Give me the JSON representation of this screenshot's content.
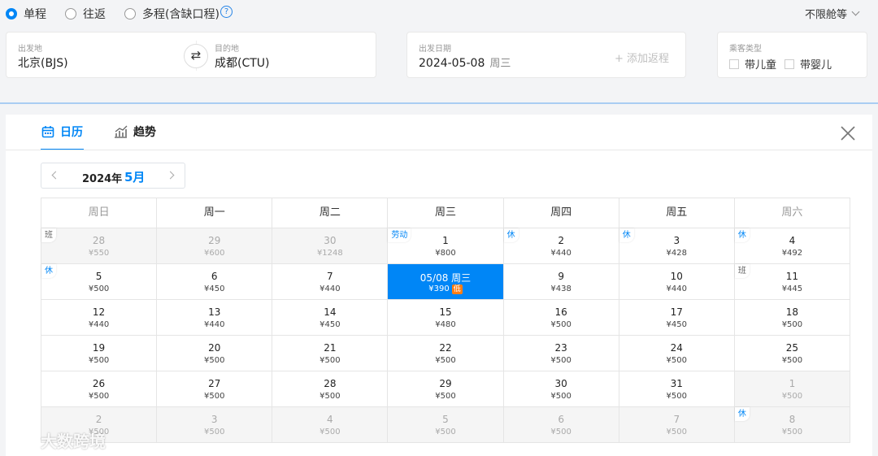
{
  "trip_types": [
    {
      "label": "单程",
      "checked": true
    },
    {
      "label": "往返",
      "checked": false
    },
    {
      "label": "多程(含缺口程)",
      "checked": false
    }
  ],
  "help_icon": "?",
  "cabin": {
    "label": "不限舱等"
  },
  "search": {
    "from_label": "出发地",
    "from_value": "北京(BJS)",
    "to_label": "目的地",
    "to_value": "成都(CTU)",
    "swap_icon": "⇄",
    "date_label": "出发日期",
    "date_value": "2024-05-08",
    "date_weekday": "周三",
    "add_return": "+ 添加返程",
    "passenger_label": "乘客类型",
    "child_label": "带儿童",
    "infant_label": "带婴儿"
  },
  "calendar": {
    "tabs": [
      {
        "label": "日历",
        "icon": "calendar-icon",
        "active": true
      },
      {
        "label": "趋势",
        "icon": "trend-icon",
        "active": false
      }
    ],
    "year": "2024年",
    "month": "5月",
    "weekdays": [
      "周日",
      "周一",
      "周二",
      "周三",
      "周四",
      "周五",
      "周六"
    ],
    "weeks": [
      [
        {
          "day": "28",
          "price": "¥550",
          "other": true,
          "tag": "班"
        },
        {
          "day": "29",
          "price": "¥600",
          "other": true
        },
        {
          "day": "30",
          "price": "¥1248",
          "other": true
        },
        {
          "day": "1",
          "price": "¥800",
          "tag": "劳动"
        },
        {
          "day": "2",
          "price": "¥440",
          "tag": "休"
        },
        {
          "day": "3",
          "price": "¥428",
          "tag": "休"
        },
        {
          "day": "4",
          "price": "¥492",
          "tag": "休"
        }
      ],
      [
        {
          "day": "5",
          "price": "¥500",
          "tag": "休"
        },
        {
          "day": "6",
          "price": "¥450"
        },
        {
          "day": "7",
          "price": "¥440"
        },
        {
          "day": "05/08 周三",
          "price": "¥390",
          "selected": true,
          "low": "低"
        },
        {
          "day": "9",
          "price": "¥438"
        },
        {
          "day": "10",
          "price": "¥440"
        },
        {
          "day": "11",
          "price": "¥445",
          "tag": "班"
        }
      ],
      [
        {
          "day": "12",
          "price": "¥440"
        },
        {
          "day": "13",
          "price": "¥440"
        },
        {
          "day": "14",
          "price": "¥450"
        },
        {
          "day": "15",
          "price": "¥480"
        },
        {
          "day": "16",
          "price": "¥500"
        },
        {
          "day": "17",
          "price": "¥450"
        },
        {
          "day": "18",
          "price": "¥500"
        }
      ],
      [
        {
          "day": "19",
          "price": "¥500"
        },
        {
          "day": "20",
          "price": "¥500"
        },
        {
          "day": "21",
          "price": "¥500"
        },
        {
          "day": "22",
          "price": "¥500"
        },
        {
          "day": "23",
          "price": "¥500"
        },
        {
          "day": "24",
          "price": "¥500"
        },
        {
          "day": "25",
          "price": "¥500"
        }
      ],
      [
        {
          "day": "26",
          "price": "¥500"
        },
        {
          "day": "27",
          "price": "¥500"
        },
        {
          "day": "28",
          "price": "¥500"
        },
        {
          "day": "29",
          "price": "¥500"
        },
        {
          "day": "30",
          "price": "¥500"
        },
        {
          "day": "31",
          "price": "¥500"
        },
        {
          "day": "1",
          "price": "¥500",
          "other": true
        }
      ],
      [
        {
          "day": "2",
          "price": "¥500",
          "other": true
        },
        {
          "day": "3",
          "price": "¥500",
          "other": true
        },
        {
          "day": "4",
          "price": "¥500",
          "other": true
        },
        {
          "day": "5",
          "price": "¥500",
          "other": true
        },
        {
          "day": "6",
          "price": "¥500",
          "other": true
        },
        {
          "day": "7",
          "price": "¥500",
          "other": true
        },
        {
          "day": "8",
          "price": "¥500",
          "other": true,
          "tag": "休"
        }
      ]
    ]
  },
  "watermark": "大数跨境",
  "colors": {
    "accent": "#0086f6",
    "low_badge": "#ff7d13"
  }
}
